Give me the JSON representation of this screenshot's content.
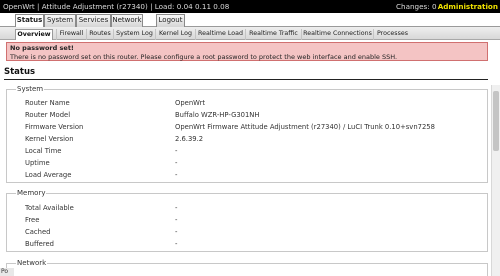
{
  "topbar": {
    "title": "OpenWrt | Attitude Adjustment (r27340) | Load: 0.04 0.11 0.08",
    "changes": "Changes: 0",
    "admin": "Administration"
  },
  "main_tabs": [
    "Status",
    "System",
    "Services",
    "Network",
    "Logout"
  ],
  "sub_tabs": [
    "Overview",
    "Firewall",
    "Routes",
    "System Log",
    "Kernel Log",
    "Realtime Load",
    "Realtime Traffic",
    "Realtime Connections",
    "Processes"
  ],
  "error": {
    "title": "No password set!",
    "text": "There is no password set on this router. Please configure a root password to protect the web interface and enable SSH."
  },
  "page_title": "Status",
  "system": {
    "legend": "System",
    "rows": [
      {
        "label": "Router Name",
        "value": "OpenWrt"
      },
      {
        "label": "Router Model",
        "value": "Buffalo WZR-HP-G301NH"
      },
      {
        "label": "Firmware Version",
        "value": "OpenWrt Firmware Attitude Adjustment (r27340) / LuCI Trunk 0.10+svn7258"
      },
      {
        "label": "Kernel Version",
        "value": "2.6.39.2"
      },
      {
        "label": "Local Time",
        "value": "-"
      },
      {
        "label": "Uptime",
        "value": "-"
      },
      {
        "label": "Load Average",
        "value": "-"
      }
    ]
  },
  "memory": {
    "legend": "Memory",
    "rows": [
      {
        "label": "Total Available",
        "value": "-"
      },
      {
        "label": "Free",
        "value": "-"
      },
      {
        "label": "Cached",
        "value": "-"
      },
      {
        "label": "Buffered",
        "value": "-"
      }
    ]
  },
  "network": {
    "legend": "Network"
  },
  "bottom_tip": "Po"
}
